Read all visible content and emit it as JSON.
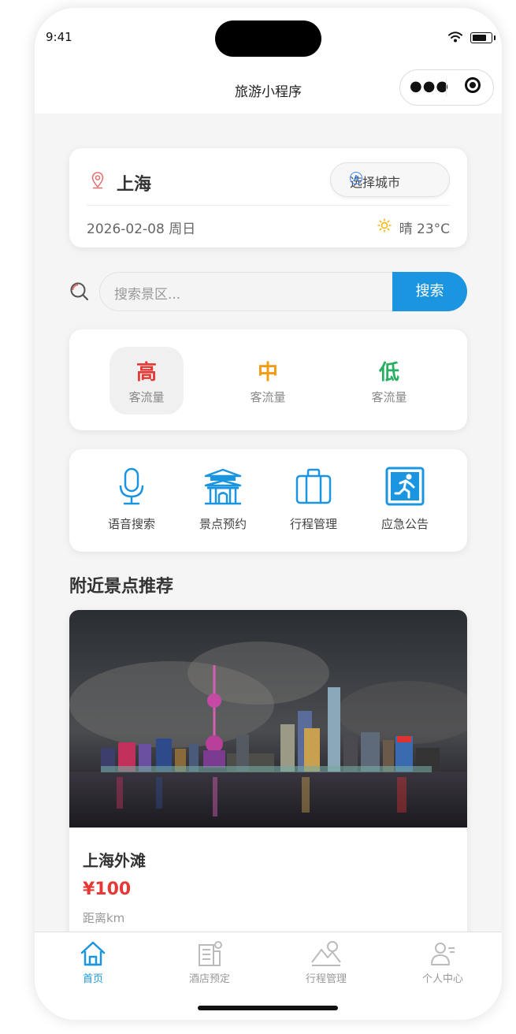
{
  "status_bar": {
    "time": "9:41"
  },
  "nav": {
    "title": "旅游小程序",
    "menu_icon": "more-dots-icon",
    "close_icon": "target-icon"
  },
  "location": {
    "city": "上海",
    "select_city_label": "选择城市",
    "date": "2026-02-08 周日",
    "weather": "晴 23°C"
  },
  "search": {
    "placeholder": "搜索景区...",
    "button_label": "搜索"
  },
  "flow": [
    {
      "level": "高",
      "label": "客流量",
      "color": "#e53935",
      "selected": true
    },
    {
      "level": "中",
      "label": "客流量",
      "color": "#f39c12",
      "selected": false
    },
    {
      "level": "低",
      "label": "客流量",
      "color": "#27ae60",
      "selected": false
    }
  ],
  "features": [
    {
      "label": "语音搜索",
      "icon": "microphone-icon"
    },
    {
      "label": "景点预约",
      "icon": "pavilion-icon"
    },
    {
      "label": "行程管理",
      "icon": "briefcase-icon"
    },
    {
      "label": "应急公告",
      "icon": "emergency-exit-icon"
    }
  ],
  "nearby": {
    "title": "附近景点推荐",
    "items": [
      {
        "name": "上海外滩",
        "price": "¥100",
        "distance": "距离km",
        "image": "bund-night-skyline"
      }
    ]
  },
  "tabbar": [
    {
      "label": "首页",
      "icon": "home-icon",
      "active": true
    },
    {
      "label": "酒店预定",
      "icon": "hotel-icon",
      "active": false
    },
    {
      "label": "行程管理",
      "icon": "mountain-icon",
      "active": false
    },
    {
      "label": "个人中心",
      "icon": "user-icon",
      "active": false
    }
  ],
  "colors": {
    "primary": "#1b95e0",
    "price": "#e53935",
    "background": "#f5f5f5"
  }
}
